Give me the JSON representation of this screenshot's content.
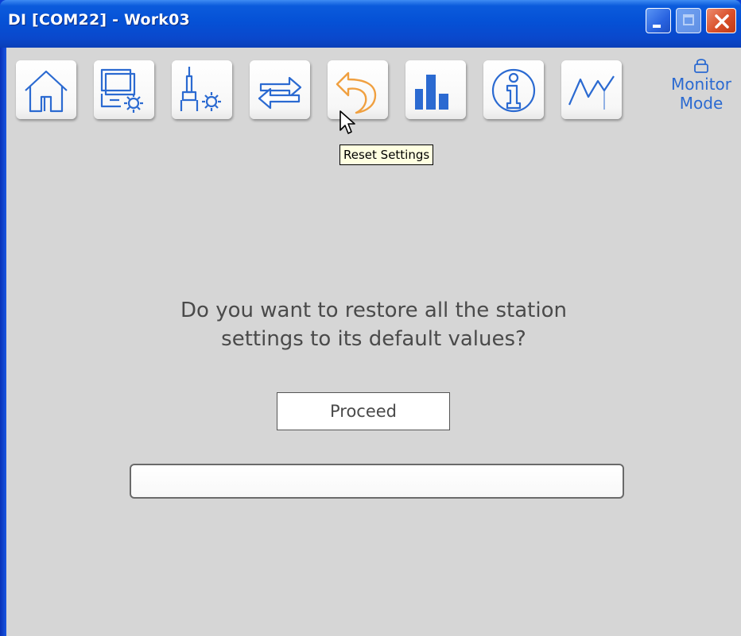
{
  "window": {
    "title": "DI [COM22] - Work03"
  },
  "toolbar": {
    "buttons": [
      {
        "name": "home",
        "icon": "home-icon"
      },
      {
        "name": "station-settings",
        "icon": "station-settings-icon"
      },
      {
        "name": "tool-settings",
        "icon": "tool-settings-icon"
      },
      {
        "name": "transfer",
        "icon": "transfer-arrows-icon"
      },
      {
        "name": "reset-settings",
        "icon": "reset-undo-icon"
      },
      {
        "name": "counters",
        "icon": "bar-chart-icon"
      },
      {
        "name": "information",
        "icon": "info-icon"
      },
      {
        "name": "graphics",
        "icon": "line-graph-icon"
      }
    ],
    "monitor_mode": {
      "line1": "Monitor",
      "line2": "Mode",
      "icon": "lock-icon"
    }
  },
  "tooltip": {
    "text": "Reset Settings"
  },
  "main": {
    "question_line1": "Do you want to restore all the station",
    "question_line2": "settings to its default values?",
    "proceed_label": "Proceed",
    "progress_fraction": 0
  },
  "colors": {
    "icon_blue": "#2b6ad1",
    "icon_orange": "#f0a040",
    "client_bg": "#d6d6d6",
    "titlebar_blue": "#0551d6"
  }
}
